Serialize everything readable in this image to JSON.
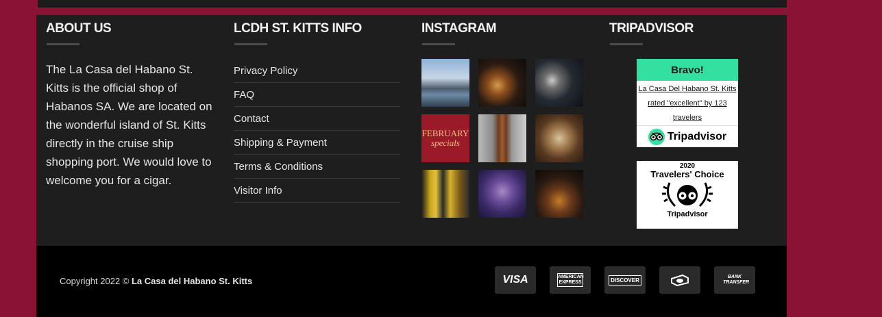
{
  "about": {
    "title": "ABOUT US",
    "text": "The La Casa del Habano St. Kitts is the official shop of Habanos SA. We are located on the wonderful island of St. Kitts directly in the cruise ship shopping port. We would love to welcome you for a cigar."
  },
  "info": {
    "title": "LCDH ST. KITTS INFO",
    "links": [
      "Privacy Policy",
      "FAQ",
      "Contact",
      "Shipping & Payment",
      "Terms & Conditions",
      "Visitor Info"
    ]
  },
  "instagram": {
    "title": "INSTAGRAM",
    "thumb_text_1": "FEBRUARY",
    "thumb_text_2": "specials"
  },
  "tripadvisor": {
    "title": "TRIPADVISOR",
    "widget_heading": "Bravo!",
    "widget_text": "La Casa Del Habano St. Kitts rated \"excellent\" by 123 travelers",
    "logo_text": "Tripadvisor",
    "award_year": "2020",
    "award_name": "Travelers' Choice",
    "award_brand": "Tripadvisor"
  },
  "bottom": {
    "copyright": "Copyright 2022 ©",
    "company": "La Casa del Habano St. Kitts",
    "payments": [
      "VISA",
      "AMERICAN EXPRESS",
      "DISCOVER",
      "cash-icon",
      "BANK TRANSFER"
    ]
  },
  "colors": {
    "page_background": "#8a1235",
    "footer_background": "#1e1e1e",
    "bottom_background": "#000000",
    "tripadvisor_green": "#34e0a1"
  }
}
